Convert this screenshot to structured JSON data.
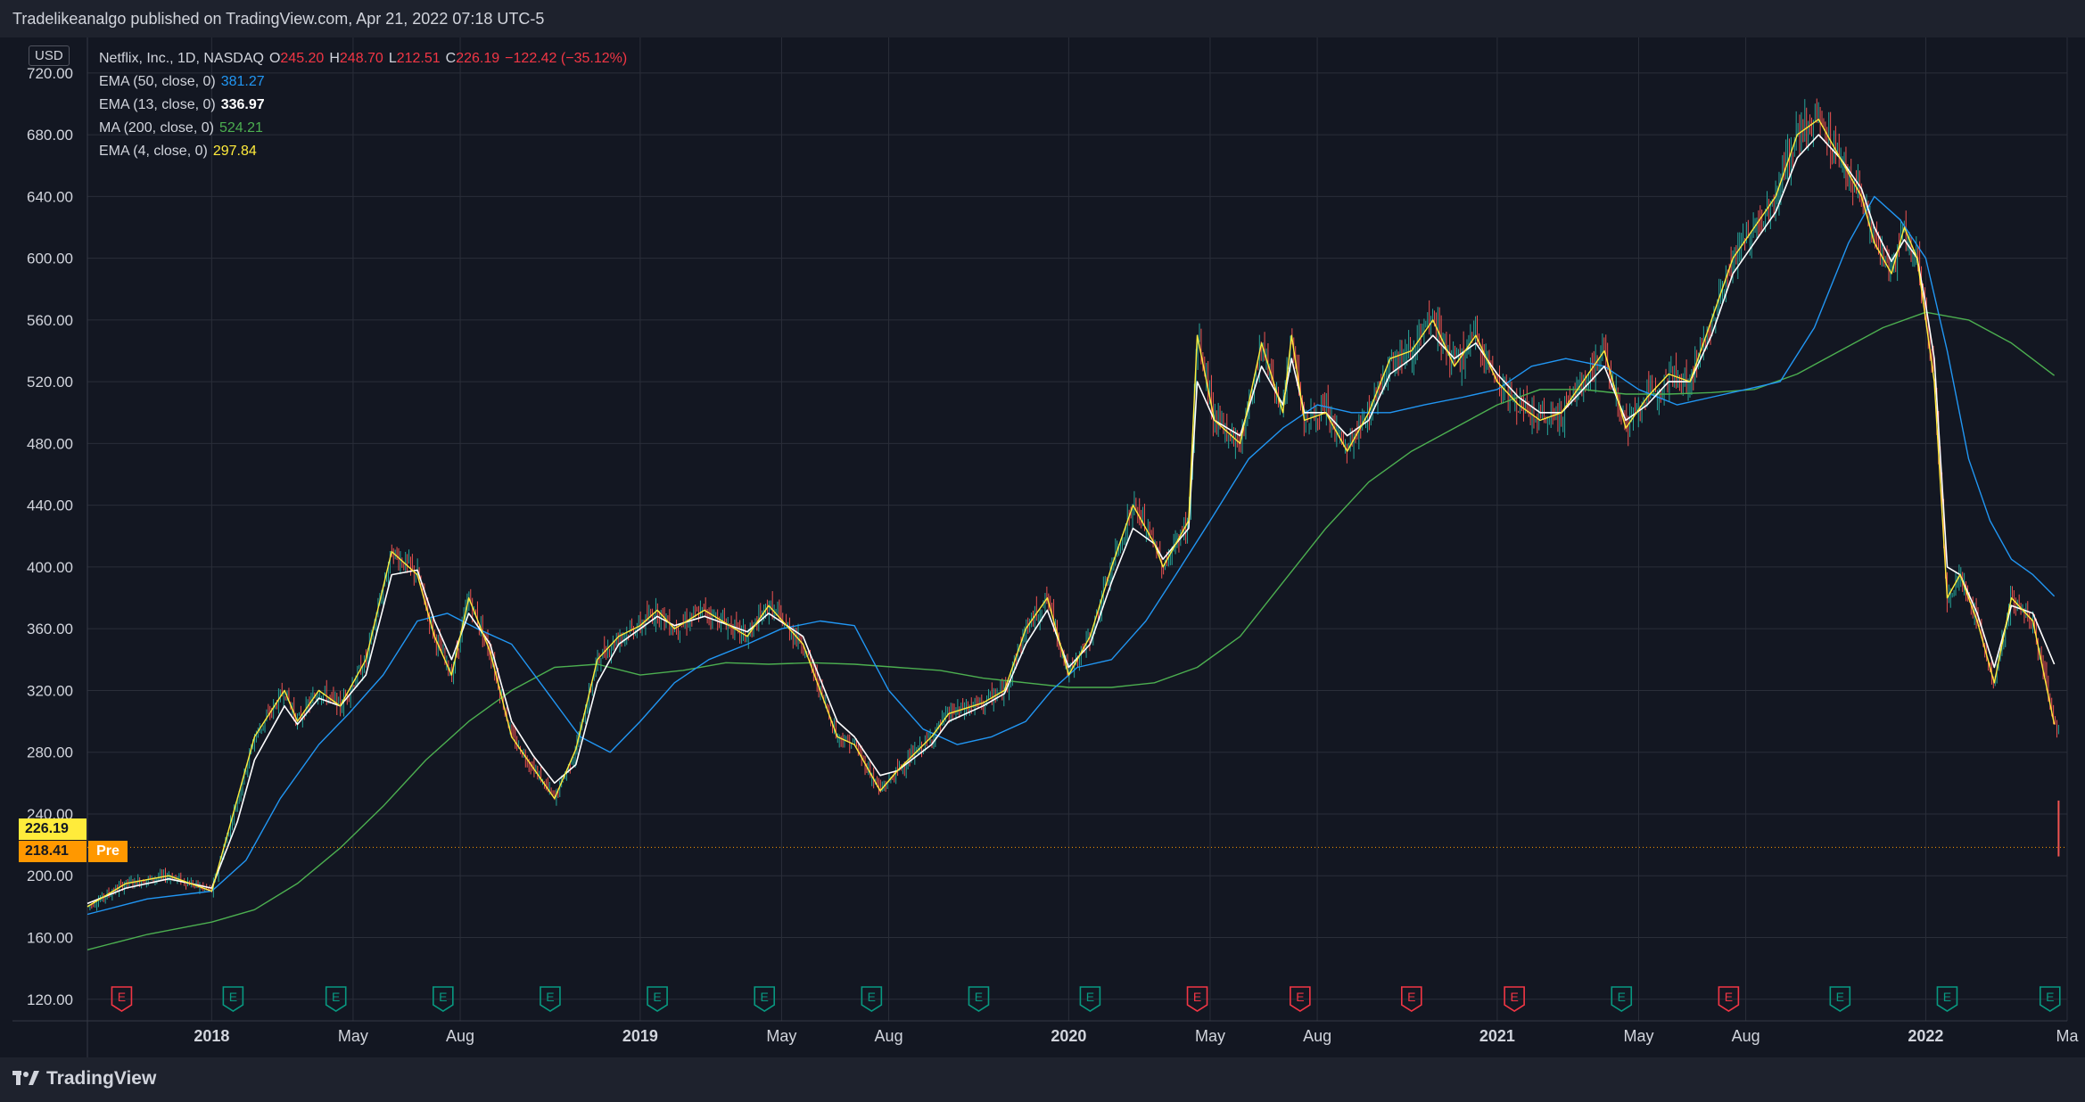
{
  "header": {
    "published_text": "Tradelikeanalgo published on TradingView.com, Apr 21, 2022 07:18 UTC-5"
  },
  "footer": {
    "brand": "TradingView"
  },
  "currency": "USD",
  "legend": {
    "symbol": "Netflix, Inc., 1D, NASDAQ",
    "open_label": "O",
    "open": "245.20",
    "high_label": "H",
    "high": "248.70",
    "low_label": "L",
    "low": "212.51",
    "close_label": "C",
    "close": "226.19",
    "change": "−122.42 (−35.12%)",
    "indicators": [
      {
        "label": "EMA (50, close, 0)",
        "value": "381.27",
        "color": "#2196f3"
      },
      {
        "label": "EMA (13, close, 0)",
        "value": "336.97",
        "color": "#ffffff"
      },
      {
        "label": "MA (200, close, 0)",
        "value": "524.21",
        "color": "#4caf50"
      },
      {
        "label": "EMA (4, close, 0)",
        "value": "297.84",
        "color": "#ffeb3b"
      }
    ]
  },
  "price_tags": {
    "last": "226.19",
    "pre": "218.41",
    "pre_label": "Pre"
  },
  "colors": {
    "background": "#131722",
    "grid": "#2a2e39",
    "up": "#26a69a",
    "down": "#ef5350",
    "ema50": "#2196f3",
    "ema13": "#ffffff",
    "ma200": "#4caf50",
    "ema4": "#ffeb3b",
    "earnings_red": "#f23645",
    "earnings_green": "#089981"
  },
  "chart_data": {
    "type": "line",
    "title": "",
    "xlabel": "",
    "ylabel": "",
    "ylim": [
      106,
      743
    ],
    "y_ticks": [
      "120.00",
      "160.00",
      "200.00",
      "240.00",
      "280.00",
      "320.00",
      "360.00",
      "400.00",
      "440.00",
      "480.00",
      "520.00",
      "560.00",
      "600.00",
      "640.00",
      "680.00",
      "720.00"
    ],
    "x_ticks": [
      {
        "label": "2018",
        "t": 2018.0
      },
      {
        "label": "May",
        "t": 2018.33
      },
      {
        "label": "Aug",
        "t": 2018.58
      },
      {
        "label": "2019",
        "t": 2019.0
      },
      {
        "label": "May",
        "t": 2019.33
      },
      {
        "label": "Aug",
        "t": 2019.58
      },
      {
        "label": "2020",
        "t": 2020.0
      },
      {
        "label": "May",
        "t": 2020.33
      },
      {
        "label": "Aug",
        "t": 2020.58
      },
      {
        "label": "2021",
        "t": 2021.0
      },
      {
        "label": "May",
        "t": 2021.33
      },
      {
        "label": "Aug",
        "t": 2021.58
      },
      {
        "label": "2022",
        "t": 2022.0
      },
      {
        "label": "Ma",
        "t": 2022.33
      }
    ],
    "xlim": [
      2017.71,
      2022.33
    ],
    "series": [
      {
        "name": "EMA (4, close, 0)",
        "color": "#ffeb3b",
        "x": [
          2017.71,
          2017.8,
          2017.9,
          2018.0,
          2018.06,
          2018.1,
          2018.17,
          2018.2,
          2018.25,
          2018.3,
          2018.36,
          2018.42,
          2018.48,
          2018.52,
          2018.56,
          2018.6,
          2018.65,
          2018.7,
          2018.75,
          2018.8,
          2018.85,
          2018.9,
          2018.95,
          2019.0,
          2019.04,
          2019.08,
          2019.15,
          2019.25,
          2019.3,
          2019.38,
          2019.46,
          2019.5,
          2019.56,
          2019.6,
          2019.68,
          2019.72,
          2019.8,
          2019.85,
          2019.9,
          2019.95,
          2020.0,
          2020.05,
          2020.1,
          2020.15,
          2020.2,
          2020.22,
          2020.28,
          2020.3,
          2020.34,
          2020.4,
          2020.45,
          2020.5,
          2020.52,
          2020.55,
          2020.6,
          2020.65,
          2020.7,
          2020.75,
          2020.8,
          2020.85,
          2020.9,
          2020.95,
          2021.0,
          2021.05,
          2021.1,
          2021.15,
          2021.2,
          2021.25,
          2021.3,
          2021.35,
          2021.4,
          2021.45,
          2021.5,
          2021.55,
          2021.6,
          2021.65,
          2021.7,
          2021.75,
          2021.8,
          2021.85,
          2021.88,
          2021.92,
          2021.95,
          2021.98,
          2022.0,
          2022.02,
          2022.05,
          2022.08,
          2022.12,
          2022.16,
          2022.2,
          2022.25,
          2022.3
        ],
        "y": [
          180,
          195,
          200,
          190,
          250,
          290,
          320,
          300,
          320,
          310,
          340,
          410,
          395,
          355,
          330,
          380,
          345,
          290,
          270,
          250,
          282,
          340,
          355,
          362,
          372,
          360,
          372,
          355,
          375,
          350,
          290,
          285,
          255,
          268,
          290,
          305,
          312,
          320,
          360,
          380,
          330,
          355,
          400,
          440,
          415,
          400,
          430,
          550,
          495,
          480,
          545,
          500,
          550,
          495,
          500,
          475,
          500,
          535,
          540,
          560,
          530,
          550,
          520,
          505,
          495,
          500,
          520,
          540,
          490,
          510,
          525,
          520,
          560,
          600,
          620,
          640,
          680,
          690,
          665,
          640,
          610,
          590,
          620,
          600,
          560,
          520,
          380,
          395,
          365,
          325,
          380,
          365,
          298
        ]
      },
      {
        "name": "EMA (13, close, 0)",
        "color": "#ffffff",
        "x": [
          2017.71,
          2017.8,
          2017.9,
          2018.0,
          2018.06,
          2018.1,
          2018.17,
          2018.2,
          2018.25,
          2018.3,
          2018.36,
          2018.42,
          2018.48,
          2018.52,
          2018.56,
          2018.6,
          2018.65,
          2018.7,
          2018.75,
          2018.8,
          2018.85,
          2018.9,
          2018.95,
          2019.0,
          2019.04,
          2019.08,
          2019.15,
          2019.25,
          2019.3,
          2019.38,
          2019.46,
          2019.5,
          2019.56,
          2019.6,
          2019.68,
          2019.72,
          2019.8,
          2019.85,
          2019.9,
          2019.95,
          2020.0,
          2020.05,
          2020.1,
          2020.15,
          2020.2,
          2020.22,
          2020.28,
          2020.3,
          2020.34,
          2020.4,
          2020.45,
          2020.5,
          2020.52,
          2020.55,
          2020.6,
          2020.65,
          2020.7,
          2020.75,
          2020.8,
          2020.85,
          2020.9,
          2020.95,
          2021.0,
          2021.05,
          2021.1,
          2021.15,
          2021.2,
          2021.25,
          2021.3,
          2021.35,
          2021.4,
          2021.45,
          2021.5,
          2021.55,
          2021.6,
          2021.65,
          2021.7,
          2021.75,
          2021.8,
          2021.85,
          2021.88,
          2021.92,
          2021.95,
          2021.98,
          2022.0,
          2022.02,
          2022.05,
          2022.08,
          2022.12,
          2022.16,
          2022.2,
          2022.25,
          2022.3
        ],
        "y": [
          182,
          192,
          198,
          192,
          235,
          275,
          310,
          298,
          315,
          310,
          330,
          395,
          398,
          365,
          340,
          370,
          350,
          300,
          278,
          260,
          272,
          325,
          350,
          360,
          368,
          362,
          368,
          358,
          370,
          355,
          300,
          290,
          265,
          268,
          285,
          300,
          310,
          318,
          350,
          372,
          335,
          350,
          390,
          425,
          415,
          405,
          425,
          520,
          495,
          485,
          530,
          505,
          535,
          500,
          500,
          485,
          495,
          525,
          535,
          550,
          535,
          545,
          525,
          510,
          500,
          500,
          515,
          530,
          495,
          505,
          520,
          520,
          550,
          590,
          610,
          630,
          665,
          680,
          665,
          645,
          620,
          598,
          612,
          600,
          570,
          535,
          400,
          395,
          370,
          335,
          375,
          370,
          337
        ]
      },
      {
        "name": "EMA (50, close, 0)",
        "color": "#2196f3",
        "x": [
          2017.71,
          2017.85,
          2018.0,
          2018.08,
          2018.16,
          2018.25,
          2018.32,
          2018.4,
          2018.48,
          2018.55,
          2018.62,
          2018.7,
          2018.78,
          2018.86,
          2018.93,
          2019.0,
          2019.08,
          2019.16,
          2019.25,
          2019.33,
          2019.42,
          2019.5,
          2019.58,
          2019.66,
          2019.74,
          2019.82,
          2019.9,
          2019.96,
          2020.02,
          2020.1,
          2020.18,
          2020.25,
          2020.33,
          2020.42,
          2020.5,
          2020.58,
          2020.66,
          2020.75,
          2020.83,
          2020.92,
          2021.0,
          2021.08,
          2021.16,
          2021.25,
          2021.33,
          2021.42,
          2021.5,
          2021.58,
          2021.66,
          2021.74,
          2021.82,
          2021.88,
          2021.94,
          2022.0,
          2022.05,
          2022.1,
          2022.15,
          2022.2,
          2022.25,
          2022.3
        ],
        "y": [
          175,
          185,
          190,
          210,
          250,
          285,
          305,
          330,
          365,
          370,
          360,
          350,
          320,
          290,
          280,
          300,
          325,
          340,
          350,
          360,
          365,
          362,
          320,
          295,
          285,
          290,
          300,
          320,
          335,
          340,
          365,
          395,
          430,
          470,
          490,
          505,
          500,
          500,
          505,
          510,
          515,
          530,
          535,
          530,
          515,
          505,
          510,
          515,
          520,
          555,
          610,
          640,
          625,
          600,
          540,
          470,
          430,
          405,
          395,
          381
        ]
      },
      {
        "name": "MA (200, close, 0)",
        "color": "#4caf50",
        "x": [
          2017.71,
          2017.85,
          2018.0,
          2018.1,
          2018.2,
          2018.3,
          2018.4,
          2018.5,
          2018.6,
          2018.7,
          2018.8,
          2018.9,
          2019.0,
          2019.1,
          2019.2,
          2019.3,
          2019.4,
          2019.5,
          2019.6,
          2019.7,
          2019.8,
          2019.9,
          2020.0,
          2020.1,
          2020.2,
          2020.3,
          2020.4,
          2020.5,
          2020.6,
          2020.7,
          2020.8,
          2020.9,
          2021.0,
          2021.1,
          2021.2,
          2021.3,
          2021.4,
          2021.5,
          2021.6,
          2021.7,
          2021.8,
          2021.9,
          2022.0,
          2022.1,
          2022.2,
          2022.3
        ],
        "y": [
          152,
          162,
          170,
          178,
          195,
          218,
          245,
          275,
          300,
          320,
          335,
          337,
          330,
          333,
          338,
          337,
          338,
          337,
          335,
          333,
          328,
          325,
          322,
          322,
          325,
          335,
          355,
          390,
          425,
          455,
          475,
          490,
          505,
          515,
          515,
          512,
          512,
          513,
          515,
          525,
          540,
          555,
          565,
          560,
          545,
          524
        ]
      }
    ],
    "pre_market": {
      "label": "Pre",
      "value": 218.41
    },
    "last_close": 226.19
  }
}
